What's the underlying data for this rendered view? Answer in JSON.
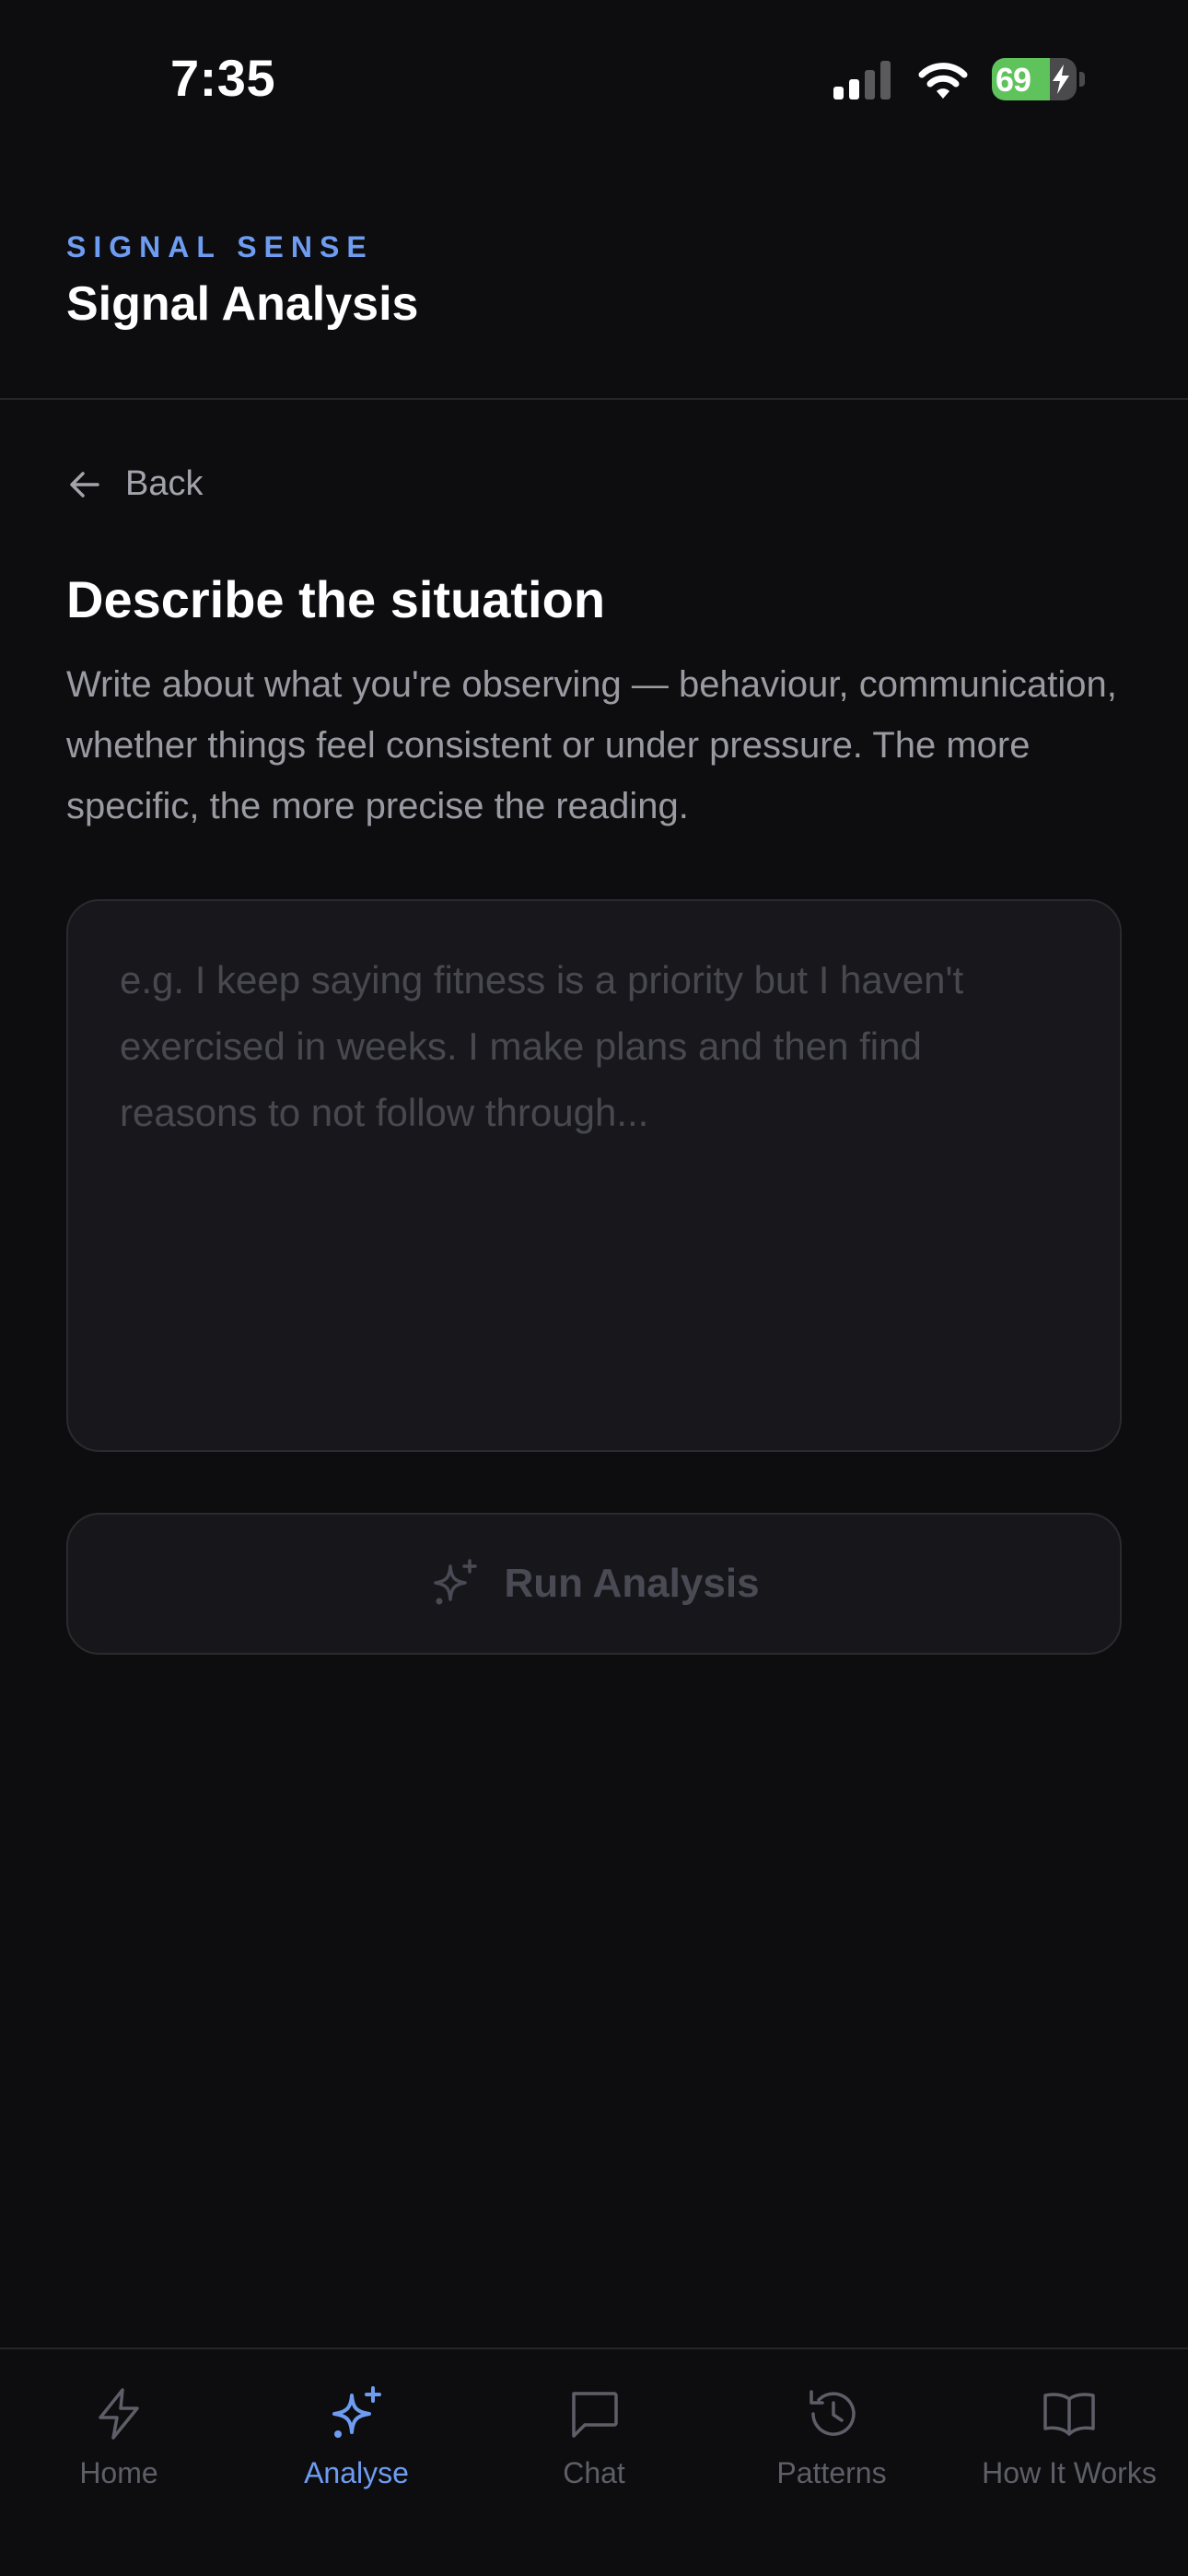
{
  "status_bar": {
    "time": "7:35",
    "battery_level": "69",
    "battery_percent": 69,
    "signal_bars_active": 2,
    "signal_bars_total": 4,
    "icons": [
      "signal-icon",
      "wifi-icon",
      "battery-charging-icon"
    ]
  },
  "header": {
    "eyebrow": "SIGNAL SENSE",
    "title": "Signal Analysis"
  },
  "back": {
    "label": "Back",
    "icon": "arrow-left-icon"
  },
  "main": {
    "title": "Describe the situation",
    "description": "Write about what you're observing — behaviour, communication, whether things feel consistent or under pressure. The more specific, the more precise the reading.",
    "input": {
      "value": "",
      "placeholder": "e.g. I keep saying fitness is a priority but I haven't exercised in weeks. I make plans and then find reasons to not follow through..."
    },
    "run_button": {
      "label": "Run Analysis",
      "icon": "sparkles-icon",
      "enabled": false
    }
  },
  "nav": {
    "active": "analyse",
    "items": [
      {
        "id": "home",
        "label": "Home",
        "icon": "lightning-icon"
      },
      {
        "id": "analyse",
        "label": "Analyse",
        "icon": "sparkles-icon"
      },
      {
        "id": "chat",
        "label": "Chat",
        "icon": "chat-bubble-icon"
      },
      {
        "id": "patterns",
        "label": "Patterns",
        "icon": "history-icon"
      },
      {
        "id": "how-it-works",
        "label": "How It Works",
        "icon": "book-icon"
      }
    ]
  },
  "colors": {
    "background": "#0d0d0f",
    "accent": "#6e9cf2",
    "muted_text": "#9a9aa2",
    "disabled_text": "#4a4a55",
    "inactive_nav": "#5e5e68",
    "battery_green": "#5fc35b"
  }
}
